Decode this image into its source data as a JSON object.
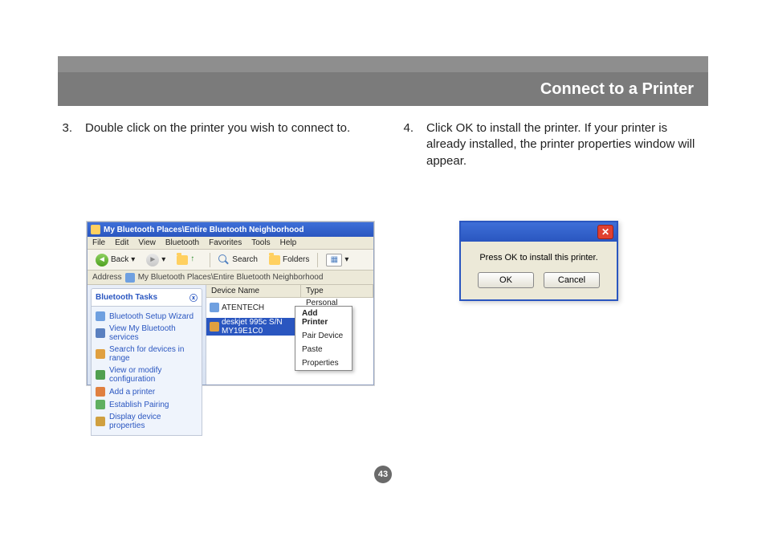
{
  "header": {
    "title": "Connect to a Printer"
  },
  "steps": [
    {
      "num": "3.",
      "text": "Double click on the printer you wish to connect to."
    },
    {
      "num": "4.",
      "text": "Click OK to install the printer. If your printer is already installed, the printer properties window will appear."
    }
  ],
  "explorer": {
    "title": "My Bluetooth Places\\Entire Bluetooth Neighborhood",
    "menus": [
      "File",
      "Edit",
      "View",
      "Bluetooth",
      "Favorites",
      "Tools",
      "Help"
    ],
    "toolbar": {
      "back": "Back",
      "search": "Search",
      "folders": "Folders"
    },
    "address_label": "Address",
    "address_value": "My Bluetooth Places\\Entire Bluetooth Neighborhood",
    "tasks_header": "Bluetooth Tasks",
    "tasks": [
      "Bluetooth Setup Wizard",
      "View My Bluetooth services",
      "Search for devices in range",
      "View or modify configuration",
      "Add a printer",
      "Establish Pairing",
      "Display device properties"
    ],
    "columns": {
      "name": "Device Name",
      "type": "Type"
    },
    "rows": [
      {
        "name": "ATENTECH",
        "type": "Personal Computer"
      },
      {
        "name": "deskjet 995c S/N MY19E1C0",
        "type": ""
      }
    ],
    "context_menu": [
      "Add Printer",
      "Pair Device",
      "Paste",
      "Properties"
    ]
  },
  "dialog": {
    "message": "Press OK to install this printer.",
    "ok": "OK",
    "cancel": "Cancel"
  },
  "page_number": "43"
}
